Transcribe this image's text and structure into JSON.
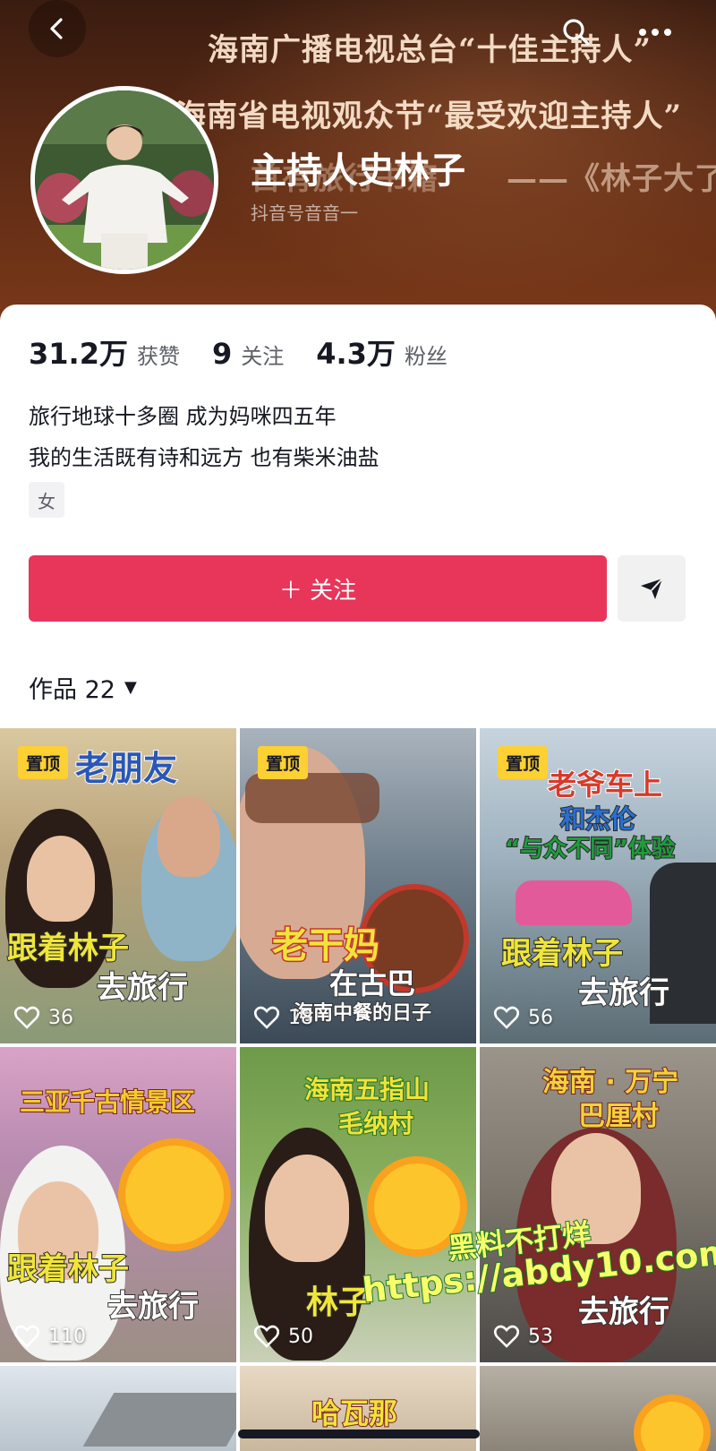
{
  "banner": {
    "line1": "海南广播电视总台“十佳主持人”",
    "line2": "海南省电视观众节“最受欢迎主持人”",
    "line3_faded": "首有旅行书籍",
    "line3": "——《林子大了》"
  },
  "profile": {
    "nickname": "主持人史林子",
    "douyin_id": "抖音号音音一",
    "stats": [
      {
        "value": "31.2万",
        "label": "获赞"
      },
      {
        "value": "9",
        "label": "关注"
      },
      {
        "value": "4.3万",
        "label": "粉丝"
      }
    ],
    "bio_line1": "旅行地球十多圈 成为妈咪四五年",
    "bio_line2": "我的生活既有诗和远方 也有柴米油盐",
    "gender": "女"
  },
  "actions": {
    "follow_label": "＋ 关注"
  },
  "works": {
    "tab_label": "作品 22",
    "pin_label": "置顶",
    "tiles": [
      {
        "likes": "36",
        "caption_top": "老朋友",
        "caption_mid": "跟着林子",
        "caption_bottom": "去旅行"
      },
      {
        "likes": "18",
        "caption_top": "老干妈",
        "caption_mid": "在古巴",
        "caption_bottom": "海南中餐的日子"
      },
      {
        "likes": "56",
        "caption_top": "老爷车上",
        "caption_mid": "和杰伦",
        "caption_sub": "“与众不同”体验",
        "caption_bottom_a": "跟着林子",
        "caption_bottom": "去旅行"
      },
      {
        "likes": "110",
        "caption_top": "三亚千古情景区",
        "caption_mid": "跟着林子",
        "caption_bottom": "去旅行"
      },
      {
        "likes": "50",
        "caption_top": "海南五指山",
        "caption_mid": "毛纳村",
        "caption_bottom": "林子"
      },
      {
        "likes": "53",
        "caption_top": "海南 · 万宁",
        "caption_mid": "巴厘村",
        "caption_bottom": "去旅行"
      },
      {
        "caption_top": "哈瓦那"
      }
    ]
  },
  "watermark": {
    "line1": "黑料不打烊",
    "line2": "https://abdy10.com"
  },
  "colors": {
    "follow": "#e8355a",
    "pin": "#fdd033",
    "text": "#161823"
  }
}
